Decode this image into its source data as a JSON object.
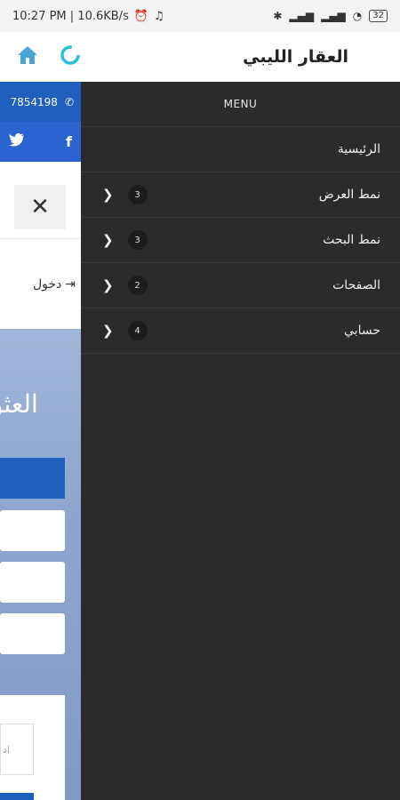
{
  "status": {
    "time": "10:27 PM | 10.6KB/s",
    "battery": "32"
  },
  "app": {
    "title": "العقار الليبي"
  },
  "background": {
    "phone": "7854198",
    "login": "دخول",
    "hero_title": "العثو",
    "field_hint": "اد"
  },
  "drawer": {
    "header": "MENU",
    "items": [
      {
        "label": "الرئيسية",
        "count": null
      },
      {
        "label": "نمط العرض",
        "count": "3"
      },
      {
        "label": "نمط البحث",
        "count": "3"
      },
      {
        "label": "الصفحات",
        "count": "2"
      },
      {
        "label": "حسابي",
        "count": "4"
      }
    ]
  },
  "colors": {
    "blue": "#1f5fbd",
    "drawer_bg": "#2b2b2b",
    "accent_cyan": "#2bbfd7"
  },
  "icons": [
    "home-icon",
    "refresh-icon",
    "phone-icon",
    "facebook-icon",
    "twitter-icon",
    "close-icon",
    "login-icon",
    "chevron-right-icon"
  ]
}
